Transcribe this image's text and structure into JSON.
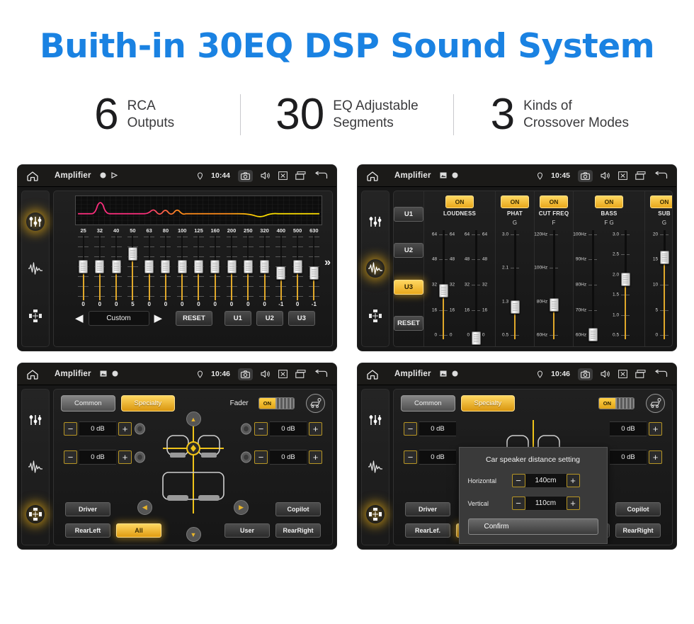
{
  "header": {
    "title": "Buith-in 30EQ DSP Sound System",
    "accent_color": "#1a82e2",
    "stats": [
      {
        "number": "6",
        "line1": "RCA",
        "line2": "Outputs"
      },
      {
        "number": "30",
        "line1": "EQ Adjustable",
        "line2": "Segments"
      },
      {
        "number": "3",
        "line1": "Kinds of",
        "line2": "Crossover Modes"
      }
    ]
  },
  "screens": {
    "eq": {
      "statusbar": {
        "title": "Amplifier",
        "time": "10:44",
        "icons": [
          "home-icon",
          "record-icon",
          "play-icon",
          "location-icon",
          "camera-icon",
          "volume-icon",
          "close-icon",
          "recents-icon",
          "back-icon"
        ]
      },
      "rail": [
        "equalizer-icon",
        "waveform-icon",
        "balance-icon"
      ],
      "rail_active": 0,
      "frequencies": [
        "25",
        "32",
        "40",
        "50",
        "63",
        "80",
        "100",
        "125",
        "160",
        "200",
        "250",
        "320",
        "400",
        "500",
        "630"
      ],
      "values": [
        "0",
        "0",
        "0",
        "5",
        "0",
        "0",
        "0",
        "0",
        "0",
        "0",
        "0",
        "0",
        "-1",
        "0",
        "-1"
      ],
      "preset": "Custom",
      "reset_label": "RESET",
      "user_presets": [
        "U1",
        "U2",
        "U3"
      ],
      "prev_icon": "left-arrow-icon",
      "next_icon": "right-arrow-icon",
      "more_icon": "chevron-double-right-icon",
      "curve_colors": [
        "#ff2e7e",
        "#ff8c1a",
        "#ffe000"
      ]
    },
    "dsp": {
      "statusbar": {
        "title": "Amplifier",
        "time": "10:45"
      },
      "rail_active": 1,
      "presets": [
        "U1",
        "U2",
        "U3"
      ],
      "preset_active": "U3",
      "reset_label": "RESET",
      "columns": [
        {
          "name": "LOUDNESS",
          "state": "ON",
          "sub": "",
          "sliders": [
            {
              "label": "",
              "ticks": [
                "64",
                "48",
                "32",
                "16",
                "0"
              ],
              "pos": 0.52
            },
            {
              "label": "",
              "ticks": [
                "64",
                "48",
                "32",
                "16",
                "0"
              ],
              "pos": 0.93
            }
          ]
        },
        {
          "name": "PHAT",
          "state": "ON",
          "sub": "G",
          "sliders": [
            {
              "label": "G",
              "ticks": [
                "3.0",
                "2.1",
                "1.3",
                "0.5"
              ],
              "pos": 0.66
            }
          ]
        },
        {
          "name": "CUT FREQ",
          "state": "ON",
          "sub": "F",
          "sliders": [
            {
              "label": "F",
              "ticks": [
                "120Hz",
                "100Hz",
                "80Hz",
                "60Hz"
              ],
              "pos": 0.64
            }
          ]
        },
        {
          "name": "BASS",
          "state": "ON",
          "sub": "F   G",
          "sliders": [
            {
              "label": "F",
              "ticks": [
                "100Hz",
                "90Hz",
                "80Hz",
                "70Hz",
                "60Hz"
              ],
              "pos": 0.9
            },
            {
              "label": "G",
              "ticks": [
                "3.0",
                "2.5",
                "2.0",
                "1.5",
                "1.0",
                "0.5"
              ],
              "pos": 0.42
            }
          ]
        },
        {
          "name": "SUB",
          "state": "ON",
          "sub": "G",
          "sliders": [
            {
              "label": "G",
              "ticks": [
                "20",
                "15",
                "10",
                "5",
                "0"
              ],
              "pos": 0.23
            }
          ]
        }
      ]
    },
    "fader": {
      "statusbar": {
        "title": "Amplifier",
        "time": "10:46"
      },
      "rail_active": 2,
      "tabs": [
        {
          "label": "Common",
          "selected": false
        },
        {
          "label": "Specialty",
          "selected": true
        }
      ],
      "fader_label": "Fader",
      "fader_state": "ON",
      "car_icon": "car-seat-icon",
      "steppers": [
        {
          "value": "0 dB",
          "minus": "−",
          "plus": "+"
        },
        {
          "value": "0 dB",
          "minus": "−",
          "plus": "+"
        },
        {
          "value": "0 dB",
          "minus": "−",
          "plus": "+"
        },
        {
          "value": "0 dB",
          "minus": "−",
          "plus": "+"
        }
      ],
      "seat_buttons": [
        {
          "label": "Driver",
          "selected": false
        },
        {
          "label": "Copilot",
          "selected": false
        },
        {
          "label": "RearLeft",
          "selected": false
        },
        {
          "label": "All",
          "selected": true
        },
        {
          "label": "User",
          "selected": false
        },
        {
          "label": "RearRight",
          "selected": false
        }
      ]
    },
    "distance": {
      "statusbar": {
        "title": "Amplifier",
        "time": "10:46"
      },
      "rail_active": 2,
      "tabs": [
        {
          "label": "Common",
          "selected": false
        },
        {
          "label": "Specialty",
          "selected": true
        }
      ],
      "fader_state": "ON",
      "steppers": [
        {
          "value": "0 dB"
        },
        {
          "value": "0 dB"
        }
      ],
      "seat_buttons": [
        {
          "label": "Driver",
          "selected": false
        },
        {
          "label": "Copilot",
          "selected": false
        },
        {
          "label": "RearLef.",
          "selected": false
        },
        {
          "label": "All",
          "selected": true
        },
        {
          "label": "User",
          "selected": false
        },
        {
          "label": "RearRight",
          "selected": false
        }
      ],
      "modal": {
        "title": "Car speaker distance setting",
        "rows": [
          {
            "label": "Horizontal",
            "value": "140cm",
            "minus": "−",
            "plus": "+"
          },
          {
            "label": "Vertical",
            "value": "110cm",
            "minus": "−",
            "plus": "+"
          }
        ],
        "confirm_label": "Confirm"
      }
    }
  }
}
